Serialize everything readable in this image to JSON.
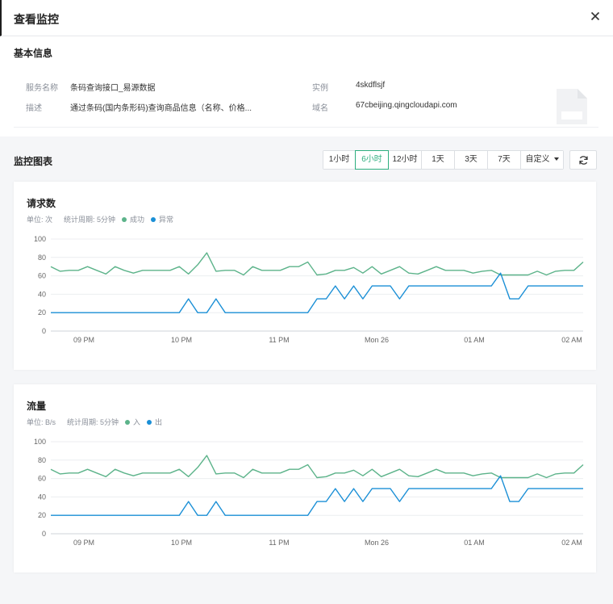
{
  "header": {
    "title": "查看监控"
  },
  "basic": {
    "title": "基本信息",
    "service_label": "服务名称",
    "service_value": "条码查询接口_易源数据",
    "instance_label": "实例",
    "instance_value": "4skdflsjf",
    "desc_label": "描述",
    "desc_value": "通过条码(国内条形码)查询商品信息（名称、价格...",
    "domain_label": "域名",
    "domain_value": "67cbeijing.qingcloudapi.com"
  },
  "monitor": {
    "title": "监控图表",
    "ranges": [
      "1小时",
      "6小时",
      "12小时",
      "1天",
      "3天",
      "7天"
    ],
    "active_range": "6小时",
    "custom_label": "自定义"
  },
  "colors": {
    "green": "#5cb38a",
    "blue": "#1a8fd6",
    "accent": "#2eae7f"
  },
  "chart_data": [
    {
      "type": "line",
      "title": "请求数",
      "unit_text": "单位: 次",
      "period_text": "统计周期: 5分钟",
      "ylim": [
        0,
        100
      ],
      "yticks": [
        0,
        20,
        40,
        60,
        80,
        100
      ],
      "xtick_labels": [
        "09 PM",
        "10 PM",
        "11 PM",
        "Mon 26",
        "01 AM",
        "02 AM"
      ],
      "grid": true,
      "series": [
        {
          "name": "成功",
          "color": "#5cb38a",
          "values": [
            70,
            65,
            66,
            66,
            70,
            66,
            62,
            70,
            66,
            63,
            66,
            66,
            66,
            66,
            70,
            62,
            72,
            85,
            65,
            66,
            66,
            61,
            70,
            66,
            66,
            66,
            70,
            70,
            75,
            61,
            62,
            66,
            66,
            69,
            63,
            70,
            62,
            66,
            70,
            63,
            62,
            66,
            70,
            66,
            66,
            66,
            63,
            65,
            66,
            61,
            61,
            61,
            61,
            65,
            61,
            65,
            66,
            66,
            75
          ]
        },
        {
          "name": "异常",
          "color": "#1a8fd6",
          "values": [
            20,
            20,
            20,
            20,
            20,
            20,
            20,
            20,
            20,
            20,
            20,
            20,
            20,
            20,
            20,
            35,
            20,
            20,
            35,
            20,
            20,
            20,
            20,
            20,
            20,
            20,
            20,
            20,
            20,
            35,
            35,
            49,
            35,
            49,
            35,
            49,
            49,
            49,
            35,
            49,
            49,
            49,
            49,
            49,
            49,
            49,
            49,
            49,
            49,
            63,
            35,
            35,
            49,
            49,
            49,
            49,
            49,
            49,
            49
          ]
        }
      ]
    },
    {
      "type": "line",
      "title": "流量",
      "unit_text": "单位: B/s",
      "period_text": "统计周期: 5分钟",
      "ylim": [
        0,
        100
      ],
      "yticks": [
        0,
        20,
        40,
        60,
        80,
        100
      ],
      "xtick_labels": [
        "09 PM",
        "10 PM",
        "11 PM",
        "Mon 26",
        "01 AM",
        "02 AM"
      ],
      "grid": true,
      "series": [
        {
          "name": "入",
          "color": "#5cb38a",
          "values": [
            70,
            65,
            66,
            66,
            70,
            66,
            62,
            70,
            66,
            63,
            66,
            66,
            66,
            66,
            70,
            62,
            72,
            85,
            65,
            66,
            66,
            61,
            70,
            66,
            66,
            66,
            70,
            70,
            75,
            61,
            62,
            66,
            66,
            69,
            63,
            70,
            62,
            66,
            70,
            63,
            62,
            66,
            70,
            66,
            66,
            66,
            63,
            65,
            66,
            61,
            61,
            61,
            61,
            65,
            61,
            65,
            66,
            66,
            75
          ]
        },
        {
          "name": "出",
          "color": "#1a8fd6",
          "values": [
            20,
            20,
            20,
            20,
            20,
            20,
            20,
            20,
            20,
            20,
            20,
            20,
            20,
            20,
            20,
            35,
            20,
            20,
            35,
            20,
            20,
            20,
            20,
            20,
            20,
            20,
            20,
            20,
            20,
            35,
            35,
            49,
            35,
            49,
            35,
            49,
            49,
            49,
            35,
            49,
            49,
            49,
            49,
            49,
            49,
            49,
            49,
            49,
            49,
            63,
            35,
            35,
            49,
            49,
            49,
            49,
            49,
            49,
            49
          ]
        }
      ]
    }
  ]
}
